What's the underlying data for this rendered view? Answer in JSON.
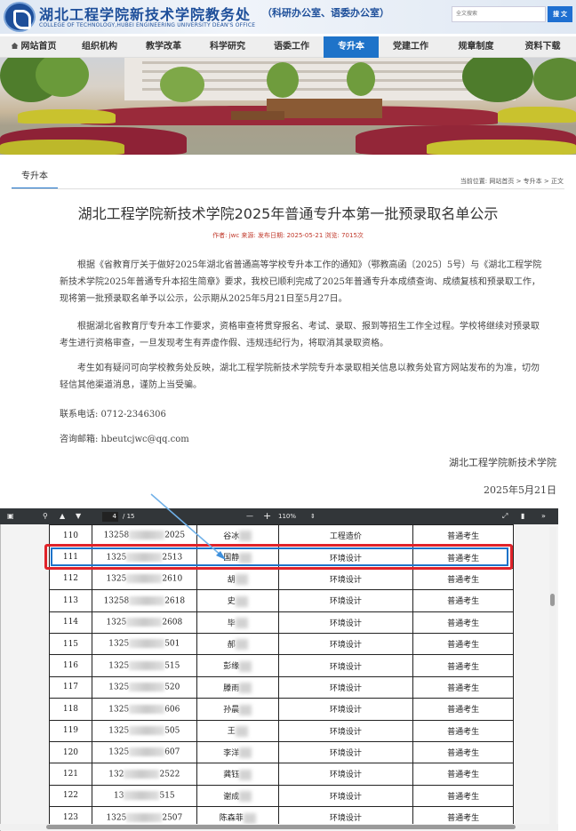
{
  "header": {
    "title_cn": "湖北工程学院新技术学院教务处",
    "subtitle_cn": "（科研办公室、语委办公室）",
    "title_en": "COLLEGE OF TECHNOLOGY,HUBEI ENGINEERING UNIVERSITY  DEAN'S OFFICE",
    "search_placeholder": "全文搜索",
    "search_button": "搜 文"
  },
  "nav": {
    "items": [
      {
        "label": "网站首页",
        "active": false
      },
      {
        "label": "组织机构",
        "active": false
      },
      {
        "label": "教学改革",
        "active": false
      },
      {
        "label": "科学研究",
        "active": false
      },
      {
        "label": "语委工作",
        "active": false
      },
      {
        "label": "专升本",
        "active": true
      },
      {
        "label": "党建工作",
        "active": false
      },
      {
        "label": "规章制度",
        "active": false
      },
      {
        "label": "资料下载",
        "active": false
      }
    ]
  },
  "section": {
    "tab": "专升本",
    "breadcrumb": "当前位置: 网站首页 > 专升本 > 正文"
  },
  "article": {
    "title": "湖北工程学院新技术学院2025年普通专升本第一批预录取名单公示",
    "meta": "作者: jwc    来源:         发布日期: 2025-05-21    浏览: 7015次",
    "p1": "根据《省教育厅关于做好2025年湖北省普通高等学校专升本工作的通知》（鄂教高函〔2025〕5号）与《湖北工程学院新技术学院2025年普通专升本招生简章》要求，我校已顺利完成了2025年普通专升本成绩查询、成绩复核和预录取工作，现将第一批预录取名单予以公示，公示期从2025年5月21日至5月27日。",
    "p2": "根据湖北省教育厅专升本工作要求，资格审查将贯穿报名、考试、录取、报到等招生工作全过程。学校将继续对预录取考生进行资格审查，一旦发现考生有弄虚作假、违规违纪行为，将取消其录取资格。",
    "p3": "考生如有疑问可向学校教务处反映，湖北工程学院新技术学院专升本录取相关信息以教务处官方网站发布的为准，切勿轻信其他渠道消息，谨防上当受骗。",
    "phone": "联系电话: 0712-2346306",
    "email": "咨询邮箱: hbeutcjwc@qq.com",
    "signature": "湖北工程学院新技术学院",
    "date": "2025年5月21日"
  },
  "pdf_viewer": {
    "page_current": "4",
    "page_total": "/ 15",
    "zoom": "110%",
    "zoom_minus": "—",
    "zoom_plus": "+"
  },
  "table_rows": [
    {
      "no": "110",
      "id_head": "13258",
      "id_tail": "2025",
      "name": "谷冰",
      "major": "工程造价",
      "type": "普通考生"
    },
    {
      "no": "111",
      "id_head": "1325",
      "id_tail": "2513",
      "name": "国静",
      "major": "环境设计",
      "type": "普通考生"
    },
    {
      "no": "112",
      "id_head": "1325",
      "id_tail": "2610",
      "name": "胡",
      "major": "环境设计",
      "type": "普通考生"
    },
    {
      "no": "113",
      "id_head": "13258",
      "id_tail": "2618",
      "name": "史",
      "major": "环境设计",
      "type": "普通考生"
    },
    {
      "no": "114",
      "id_head": "1325",
      "id_tail": "2608",
      "name": "毕",
      "major": "环境设计",
      "type": "普通考生"
    },
    {
      "no": "115",
      "id_head": "1325",
      "id_tail": "501",
      "name": "郝",
      "major": "环境设计",
      "type": "普通考生"
    },
    {
      "no": "116",
      "id_head": "1325",
      "id_tail": "515",
      "name": "彭缘",
      "major": "环境设计",
      "type": "普通考生"
    },
    {
      "no": "117",
      "id_head": "1325",
      "id_tail": "520",
      "name": "滕雨",
      "major": "环境设计",
      "type": "普通考生"
    },
    {
      "no": "118",
      "id_head": "1325",
      "id_tail": "606",
      "name": "孙晨",
      "major": "环境设计",
      "type": "普通考生"
    },
    {
      "no": "119",
      "id_head": "1325",
      "id_tail": "505",
      "name": "王",
      "major": "环境设计",
      "type": "普通考生"
    },
    {
      "no": "120",
      "id_head": "1325",
      "id_tail": "607",
      "name": "李洋",
      "major": "环境设计",
      "type": "普通考生"
    },
    {
      "no": "121",
      "id_head": "132",
      "id_tail": "2522",
      "name": "龚钰",
      "major": "环境设计",
      "type": "普通考生"
    },
    {
      "no": "122",
      "id_head": "13",
      "id_tail": "515",
      "name": "谢成",
      "major": "环境设计",
      "type": "普通考生"
    },
    {
      "no": "123",
      "id_head": "1325",
      "id_tail": "2507",
      "name": "陈森菲",
      "major": "环境设计",
      "type": "普通考生"
    }
  ],
  "colors": {
    "brand_blue": "#1e4f9a",
    "nav_active": "#1e73c9",
    "highlight_red": "#e0232a",
    "meta_red": "#c0392b"
  }
}
